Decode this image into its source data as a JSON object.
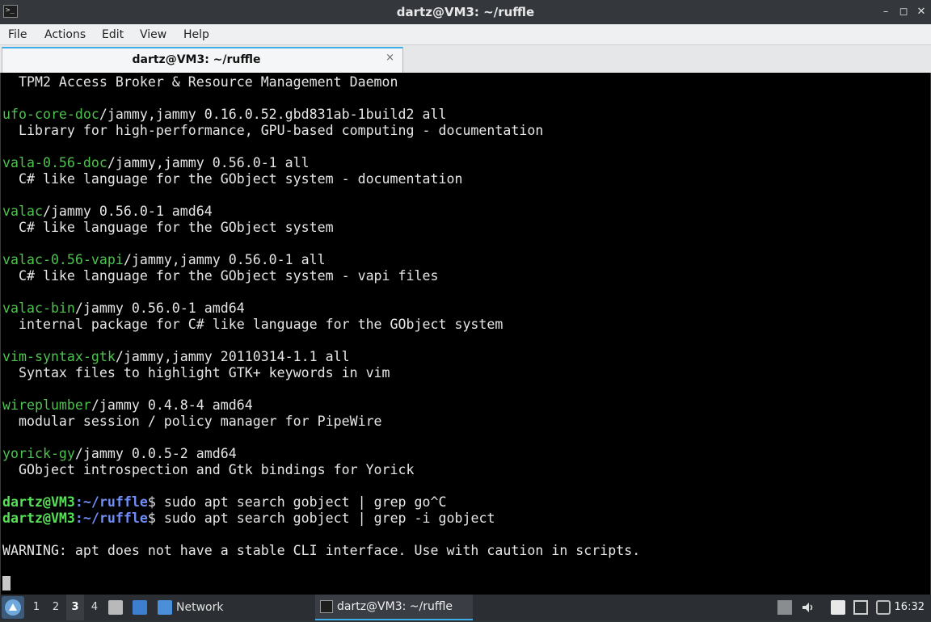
{
  "window": {
    "title": "dartz@VM3: ~/ruffle",
    "app_icon_glyph": ">_"
  },
  "window_controls": {
    "minimize": "–",
    "maximize": "◻",
    "close": "✕"
  },
  "menu": [
    "File",
    "Actions",
    "Edit",
    "View",
    "Help"
  ],
  "tab": {
    "label": "dartz@VM3: ~/ruffle",
    "close": "×"
  },
  "terminal": {
    "lines": [
      {
        "type": "desc",
        "text": "  TPM2 Access Broker & Resource Management Daemon"
      },
      {
        "type": "blank"
      },
      {
        "type": "pkg",
        "name": "ufo-core-doc",
        "rest": "/jammy,jammy 0.16.0.52.gbd831ab-1build2 all"
      },
      {
        "type": "desc",
        "text": "  Library for high-performance, GPU-based computing - documentation"
      },
      {
        "type": "blank"
      },
      {
        "type": "pkg",
        "name": "vala-0.56-doc",
        "rest": "/jammy,jammy 0.56.0-1 all"
      },
      {
        "type": "desc",
        "text": "  C# like language for the GObject system - documentation"
      },
      {
        "type": "blank"
      },
      {
        "type": "pkg",
        "name": "valac",
        "rest": "/jammy 0.56.0-1 amd64"
      },
      {
        "type": "desc",
        "text": "  C# like language for the GObject system"
      },
      {
        "type": "blank"
      },
      {
        "type": "pkg",
        "name": "valac-0.56-vapi",
        "rest": "/jammy,jammy 0.56.0-1 all"
      },
      {
        "type": "desc",
        "text": "  C# like language for the GObject system - vapi files"
      },
      {
        "type": "blank"
      },
      {
        "type": "pkg",
        "name": "valac-bin",
        "rest": "/jammy 0.56.0-1 amd64"
      },
      {
        "type": "desc",
        "text": "  internal package for C# like language for the GObject system"
      },
      {
        "type": "blank"
      },
      {
        "type": "pkg",
        "name": "vim-syntax-gtk",
        "rest": "/jammy,jammy 20110314-1.1 all"
      },
      {
        "type": "desc",
        "text": "  Syntax files to highlight GTK+ keywords in vim"
      },
      {
        "type": "blank"
      },
      {
        "type": "pkg",
        "name": "wireplumber",
        "rest": "/jammy 0.4.8-4 amd64"
      },
      {
        "type": "desc",
        "text": "  modular session / policy manager for PipeWire"
      },
      {
        "type": "blank"
      },
      {
        "type": "pkg",
        "name": "yorick-gy",
        "rest": "/jammy 0.0.5-2 amd64"
      },
      {
        "type": "desc",
        "text": "  GObject introspection and Gtk bindings for Yorick"
      },
      {
        "type": "blank"
      },
      {
        "type": "prompt",
        "user": "dartz@VM3",
        "sep": ":",
        "path": "~/ruffle",
        "cmd": "$ sudo apt search gobject | grep go^C"
      },
      {
        "type": "prompt",
        "user": "dartz@VM3",
        "sep": ":",
        "path": "~/ruffle",
        "cmd": "$ sudo apt search gobject | grep -i gobject"
      },
      {
        "type": "blank"
      },
      {
        "type": "desc",
        "text": "WARNING: apt does not have a stable CLI interface. Use with caution in scripts."
      },
      {
        "type": "blank"
      },
      {
        "type": "cursor"
      }
    ]
  },
  "taskbar": {
    "workspaces": [
      "1",
      "2",
      "3",
      "4"
    ],
    "active_workspace": "3",
    "network_label": "Network",
    "task_label": "dartz@VM3: ~/ruffle",
    "clock": "16:32"
  },
  "colors": {
    "accent": "#3daee9",
    "package": "#4ec24e",
    "prompt_user": "#57e057",
    "prompt_path": "#6f8df5"
  }
}
